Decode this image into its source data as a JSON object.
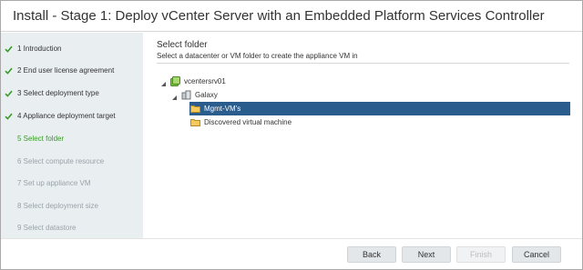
{
  "window": {
    "title": "Install - Stage 1: Deploy vCenter Server with an Embedded Platform Services Controller"
  },
  "sidebar": {
    "steps": [
      {
        "label": "1 Introduction",
        "state": "done"
      },
      {
        "label": "2 End user license agreement",
        "state": "done"
      },
      {
        "label": "3 Select deployment type",
        "state": "done"
      },
      {
        "label": "4 Appliance deployment target",
        "state": "done"
      },
      {
        "label": "5 Select folder",
        "state": "current"
      },
      {
        "label": "6 Select compute resource",
        "state": "pending"
      },
      {
        "label": "7 Set up appliance VM",
        "state": "pending"
      },
      {
        "label": "8 Select deployment size",
        "state": "pending"
      },
      {
        "label": "9 Select datastore",
        "state": "pending"
      }
    ]
  },
  "main": {
    "title": "Select folder",
    "description": "Select a datacenter or VM folder to create the appliance VM in",
    "tree": {
      "root": {
        "label": "vcentersrv01",
        "icon": "vcenter-icon",
        "expanded": true
      },
      "datacenter": {
        "label": "Galaxy",
        "icon": "datacenter-icon",
        "expanded": true
      },
      "folders": [
        {
          "label": "Mgmt-VM's",
          "icon": "folder-icon",
          "selected": true
        },
        {
          "label": "Discovered virtual machine",
          "icon": "folder-icon",
          "selected": false
        }
      ]
    }
  },
  "footer": {
    "back": "Back",
    "next": "Next",
    "finish": "Finish",
    "cancel": "Cancel",
    "finish_disabled": true
  },
  "colors": {
    "done_check": "#3a9a2a",
    "current_step": "#3a9a2a",
    "pending_step": "#9aa3a8",
    "selection": "#2b5c8e",
    "sidebar_bg": "#e9eef1"
  }
}
